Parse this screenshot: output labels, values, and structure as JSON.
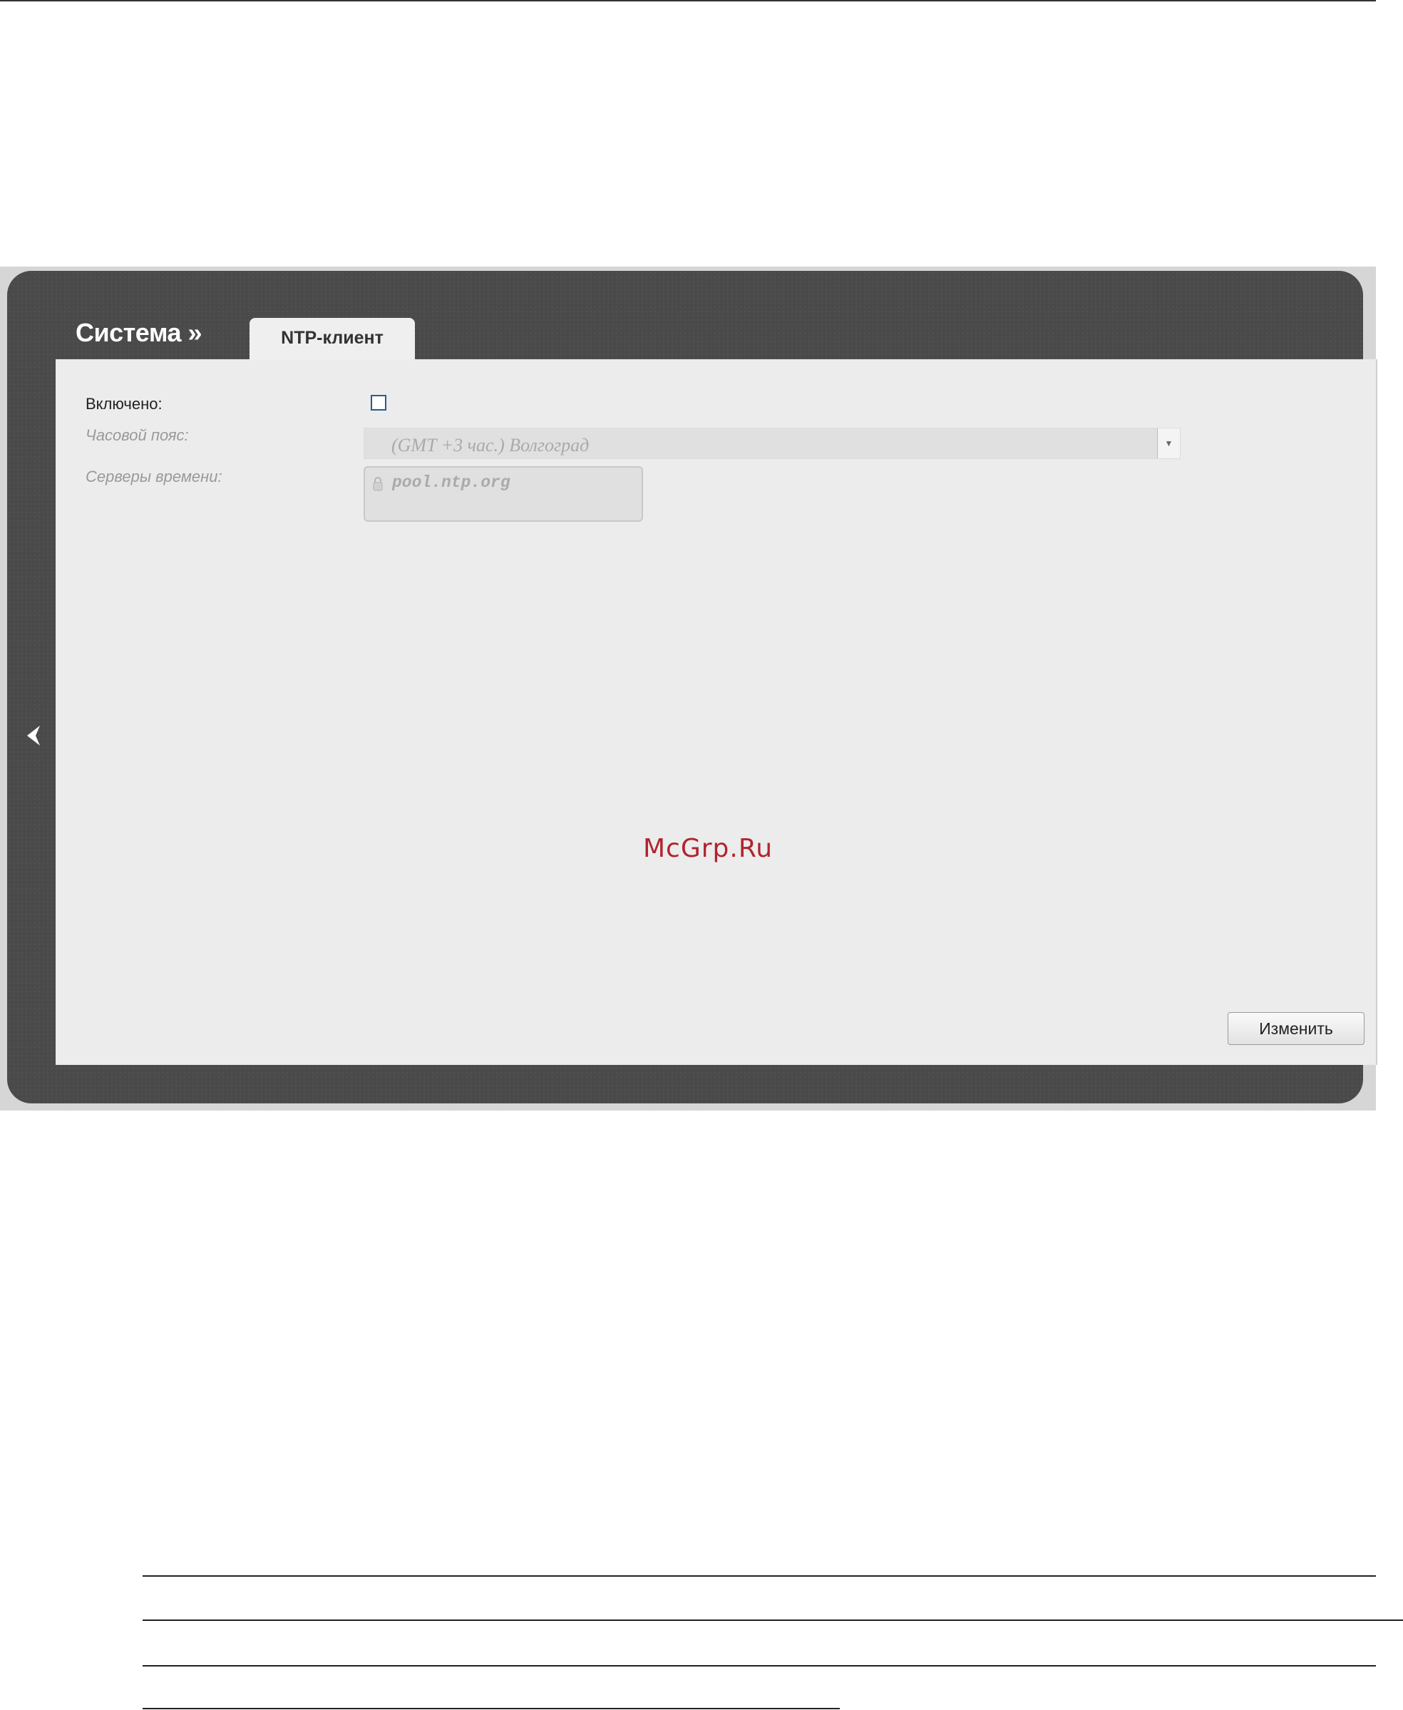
{
  "breadcrumb": {
    "section": "Система »"
  },
  "tabs": [
    {
      "label": "NTP-клиент",
      "active": true
    }
  ],
  "form": {
    "enabled": {
      "label": "Включено:",
      "checked": false
    },
    "timezone": {
      "label": "Часовой пояс:",
      "value": "(GMT +3 час.) Волгоград",
      "disabled": true
    },
    "servers": {
      "label": "Серверы времени:",
      "value": "pool.ntp.org",
      "disabled": true
    }
  },
  "actions": {
    "save_label": "Изменить"
  },
  "watermark": {
    "text": "McGrp.Ru"
  },
  "icons": {
    "back": "chevron-left-icon",
    "select_arrow": "chevron-down-icon",
    "lock": "lock-icon"
  },
  "colors": {
    "panel": "#4a4a4a",
    "card": "#ececec",
    "checkbox_border": "#2a5a8c",
    "watermark": "#b2232e"
  }
}
